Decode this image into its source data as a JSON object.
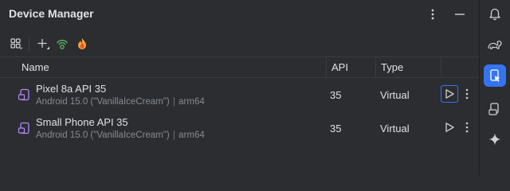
{
  "window": {
    "title": "Device Manager"
  },
  "title_actions": [
    {
      "name": "options-menu-icon"
    },
    {
      "name": "hide-panel-icon"
    }
  ],
  "toolbar": {
    "buttons": [
      {
        "name": "device-groups-icon"
      },
      {
        "name": "add-device-icon"
      },
      {
        "name": "pair-wifi-icon"
      },
      {
        "name": "firebase-icon"
      }
    ]
  },
  "table": {
    "columns": {
      "name": "Name",
      "api": "API",
      "type": "Type"
    },
    "rows": [
      {
        "name": "Pixel 8a API 35",
        "android": "Android 15.0 (\"VanillaIceCream\")",
        "sep": "|",
        "arch": "arm64",
        "api": "35",
        "type": "Virtual"
      },
      {
        "name": "Small Phone API 35",
        "android": "Android 15.0 (\"VanillaIceCream\")",
        "sep": "|",
        "arch": "arm64",
        "api": "35",
        "type": "Virtual"
      }
    ]
  },
  "stripe": [
    {
      "name": "notifications-icon",
      "active": false
    },
    {
      "name": "gradle-icon",
      "active": false
    },
    {
      "name": "device-manager-icon",
      "active": true
    },
    {
      "name": "running-devices-icon",
      "active": false
    },
    {
      "name": "gemini-icon",
      "active": false
    }
  ],
  "colors": {
    "background": "#2b2d30",
    "accent": "#3574f0",
    "text": "#dfe1e5",
    "muted_text": "#868a91",
    "device_icon": "#b189f5",
    "wifi_icon": "#5fb865"
  }
}
